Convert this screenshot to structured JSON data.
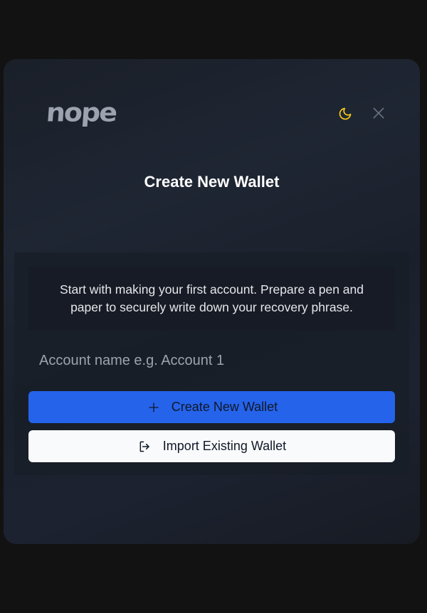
{
  "brand": {
    "logo_text": "nope"
  },
  "header": {
    "theme_icon": "moon-icon",
    "close_icon": "close-icon",
    "accent_moon": "#facc15"
  },
  "page": {
    "title": "Create New Wallet"
  },
  "info": {
    "message": "Start with making your first account. Prepare a pen and paper to securely write down your recovery phrase."
  },
  "account_input": {
    "value": "",
    "placeholder": "Account name e.g. Account 1"
  },
  "actions": {
    "create_label": "Create New Wallet",
    "create_icon": "plus-icon",
    "create_color": "#2563eb",
    "import_label": "Import Existing Wallet",
    "import_icon": "login-icon"
  }
}
